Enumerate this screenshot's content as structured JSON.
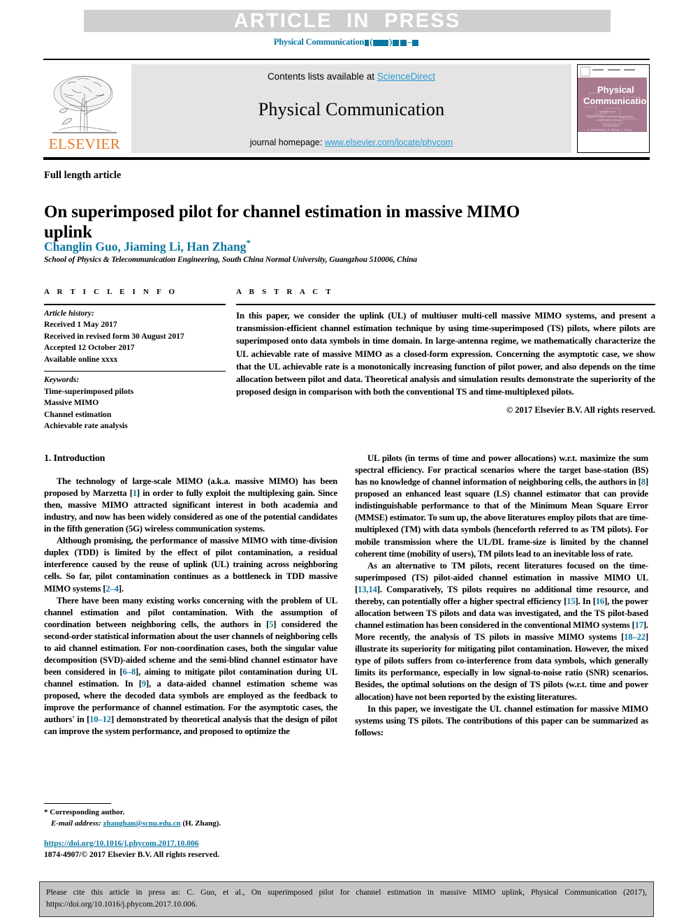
{
  "banner": {
    "label": "ARTICLE  IN  PRESS"
  },
  "running_head": {
    "journal": "Physical Communication"
  },
  "masthead": {
    "contents_prefix": "Contents lists available at ",
    "sciencedirect": "ScienceDirect",
    "journal_title": "Physical Communication",
    "homepage_prefix": "journal homepage: ",
    "homepage_url": "www.elsevier.com/locate/phycom",
    "publisher": "ELSEVIER",
    "cover_title_1": "Physical",
    "cover_title_2": "Communication"
  },
  "article": {
    "type": "Full length article",
    "title": "On superimposed pilot for channel estimation in massive MIMO uplink",
    "authors": "Changlin Guo, Jiaming Li, Han Zhang",
    "corresponding_marker": "*",
    "affiliation": "School of Physics & Telecommunication Engineering, South China Normal University, Guangzhou 510006, China"
  },
  "info": {
    "heading": "A R T I C L E   I N F O",
    "history_label": "Article history:",
    "history": [
      "Received 1 May 2017",
      "Received in revised form 30 August 2017",
      "Accepted 12 October 2017",
      "Available online xxxx"
    ],
    "keywords_label": "Keywords:",
    "keywords": [
      "Time-superimposed pilots",
      "Massive MIMO",
      "Channel estimation",
      "Achievable rate analysis"
    ]
  },
  "abstract": {
    "heading": "A B S T R A C T",
    "text": "In this paper, we consider the uplink (UL) of multiuser multi-cell massive MIMO systems, and present a transmission-efficient channel estimation technique by using time-superimposed (TS) pilots, where pilots are superimposed onto data symbols in time domain. In large-antenna regime, we mathematically characterize the UL achievable rate of massive MIMO as a closed-form expression. Concerning the asymptotic case, we show that the UL achievable rate is a monotonically increasing function of pilot power, and also depends on the time allocation between pilot and data. Theoretical analysis and simulation results demonstrate the superiority of the proposed design in comparison with both the conventional TS and time-multiplexed pilots.",
    "copyright": "© 2017 Elsevier B.V. All rights reserved."
  },
  "introduction": {
    "section_title": "1. Introduction",
    "left_paragraphs": [
      "The technology of large-scale MIMO (a.k.a. massive MIMO) has been proposed by Marzetta [1] in order to fully exploit the multiplexing gain. Since then, massive MIMO attracted significant interest in both academia and industry, and now has been widely considered as one of the potential candidates in the fifth generation (5G) wireless communication systems.",
      "Although promising, the performance of massive MIMO with time-division duplex (TDD) is limited by the effect of pilot contamination, a residual interference caused by the reuse of uplink (UL) training across neighboring cells. So far, pilot contamination continues as a bottleneck in TDD massive MIMO systems [2–4].",
      "There have been many existing works concerning with the problem of UL channel estimation and pilot contamination. With the assumption of coordination between neighboring cells, the authors in [5] considered the second-order statistical information about the user channels of neighboring cells to aid channel estimation. For non-coordination cases, both the singular value decomposition (SVD)-aided scheme and the semi-blind channel estimator have been considered in [6–8], aiming to mitigate pilot contamination during UL channel estimation. In [9], a data-aided channel estimation scheme was proposed, where the decoded data symbols are employed as the feedback to improve the performance of channel estimation. For the asymptotic cases, the authors' in [10–12] demonstrated by theoretical analysis that the design of pilot can improve the system performance, and proposed to optimize the"
    ],
    "right_paragraphs": [
      "UL pilots (in terms of time and power allocations) w.r.t. maximize the sum spectral efficiency. For practical scenarios where the target base-station (BS) has no knowledge of channel information of neighboring cells, the authors in [8] proposed an enhanced least square (LS) channel estimator that can provide indistinguishable performance to that of the Minimum Mean Square Error (MMSE) estimator. To sum up, the above literatures employ pilots that are time-multiplexed (TM) with data symbols (henceforth referred to as TM pilots). For mobile transmission where the UL/DL frame-size is limited by the channel coherent time (mobility of users), TM pilots lead to an inevitable loss of rate.",
      "As an alternative to TM pilots, recent literatures focused on the time-superimposed (TS) pilot-aided channel estimation in massive MIMO UL [13,14]. Comparatively, TS pilots requires no additional time resource, and thereby, can potentially offer a higher spectral efficiency [15]. In [16], the power allocation between TS pilots and data was investigated, and the TS pilot-based channel estimation has been considered in the conventional MIMO systems [17]. More recently, the analysis of TS pilots in massive MIMO systems [18–22] illustrate its superiority for mitigating pilot contamination. However, the mixed type of pilots suffers from co-interference from data symbols, which generally limits its performance, especially in low signal-to-noise ratio (SNR) scenarios. Besides, the optimal solutions on the design of TS pilots (w.r.t. time and power allocation) have not been reported by the existing literatures.",
      "In this paper, we investigate the UL channel estimation for massive MIMO systems using TS pilots. The contributions of this paper can be summarized as follows:"
    ]
  },
  "footnote": {
    "corresponding": "* Corresponding author.",
    "email_label": "E-mail address:",
    "email": "zhanghan@scnu.edu.cn",
    "email_suffix": "(H. Zhang)."
  },
  "doi_block": {
    "doi": "https://doi.org/10.1016/j.phycom.2017.10.006",
    "issn_line": "1874-4907/© 2017 Elsevier B.V. All rights reserved."
  },
  "citation_footer": {
    "text": "Please cite this article in press as: C. Guo, et al., On superimposed pilot for channel estimation in massive MIMO uplink, Physical Communication (2017), https://doi.org/10.1016/j.phycom.2017.10.006."
  },
  "colors": {
    "link_blue": "#0b76a0",
    "sd_blue": "#2a9bd6",
    "elsevier_orange": "#e87722",
    "banner_gray": "#cfcfcf",
    "masthead_gray": "#e4e4e4",
    "footer_gray": "#c6c6c6",
    "cover_mauve": "#a8798f"
  }
}
